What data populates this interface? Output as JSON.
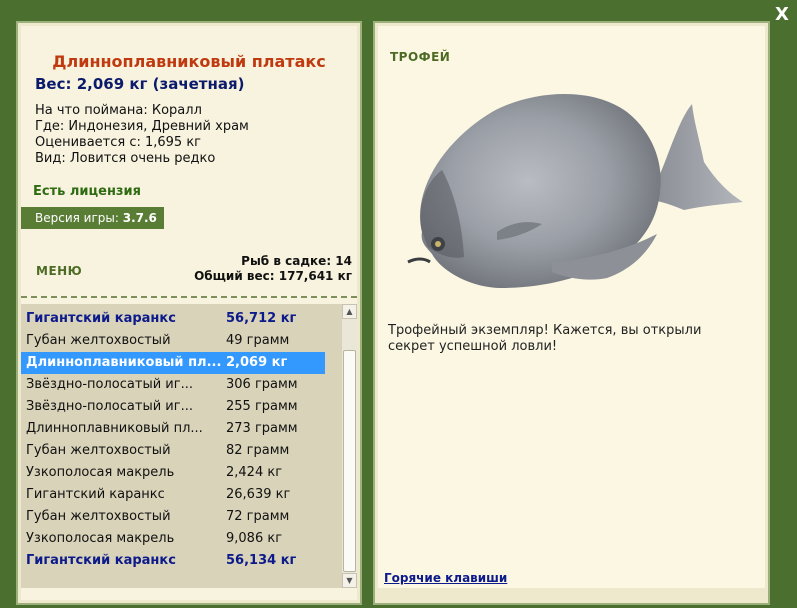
{
  "close_label": "X",
  "left": {
    "fish_name": "Длиннoплавниковый платакс",
    "weight_line": "Вес: 2,069 кг (зачетная)",
    "caught_on": "На что поймана: Коралл",
    "location": "Где: Индонезия, Древний храм",
    "valued_from": "Оценивается с: 1,695 кг",
    "rarity": "Вид: Ловится очень редко",
    "license": "Есть лицензия",
    "version_label": "Версия игры:",
    "version_value": "3.7.6",
    "menu_label": "МЕНЮ",
    "fish_in_keepnet": "Рыб в садке: 14",
    "total_weight": "Общий вес: 177,641 кг"
  },
  "catch_list": [
    {
      "name": "Гигантский каранкс",
      "weight": "56,712 кг",
      "style": "trophy"
    },
    {
      "name": "Губан желтохвостый",
      "weight": "49 грамм",
      "style": "normal"
    },
    {
      "name": "Длиннoплавниковый пл...",
      "weight": "2,069 кг",
      "style": "selected"
    },
    {
      "name": "Звёздно-полосатый иг...",
      "weight": "306 грамм",
      "style": "normal"
    },
    {
      "name": "Звёздно-полосатый иг...",
      "weight": "255 грамм",
      "style": "normal"
    },
    {
      "name": "Длиннoплавниковый пл...",
      "weight": "273 грамм",
      "style": "normal"
    },
    {
      "name": "Губан желтохвостый",
      "weight": "82 грамм",
      "style": "normal"
    },
    {
      "name": "Узкополосая макрель",
      "weight": "2,424 кг",
      "style": "normal"
    },
    {
      "name": "Гигантский каранкс",
      "weight": "26,639 кг",
      "style": "normal"
    },
    {
      "name": "Губан желтохвостый",
      "weight": "72 грамм",
      "style": "normal"
    },
    {
      "name": "Узкополосая макрель",
      "weight": "9,086 кг",
      "style": "normal"
    },
    {
      "name": "Гигантский каранкс",
      "weight": "56,134 кг",
      "style": "trophy"
    }
  ],
  "right": {
    "trophy_heading": "ТРОФЕЙ",
    "trophy_message": "Трофейный экземпляр! Кажется, вы открыли секрет успешной ловли!",
    "hotkeys_link": "Горячие клавиши"
  },
  "icons": {
    "scroll_up": "scroll-up-arrow-icon",
    "scroll_down": "scroll-down-arrow-icon"
  },
  "colors": {
    "background_green": "#4a6f2f",
    "title_orange": "#c03a10",
    "trophy_blue": "#0c1a8b",
    "selection_blue": "#3399ff",
    "license_green": "#2f6b12"
  }
}
